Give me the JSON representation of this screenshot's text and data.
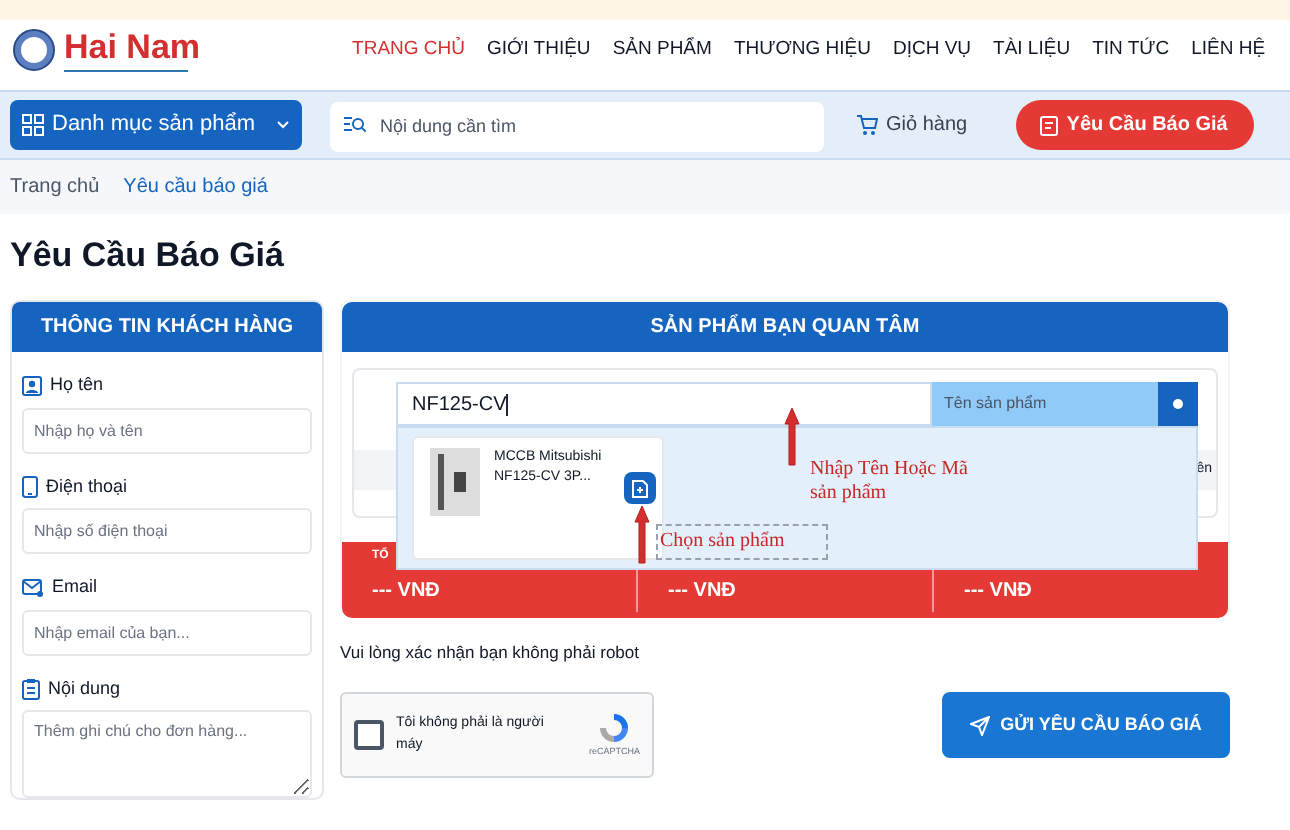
{
  "logo": {
    "name": "Hai Nam"
  },
  "nav": [
    {
      "label": "TRANG CHỦ",
      "selected": true
    },
    {
      "label": "GIỚI THIỆU",
      "selected": false
    },
    {
      "label": "SẢN PHẨM",
      "selected": false
    },
    {
      "label": "THƯƠNG HIỆU",
      "selected": false
    },
    {
      "label": "DỊCH VỤ",
      "selected": false
    },
    {
      "label": "TÀI LIỆU",
      "selected": false
    },
    {
      "label": "TIN TỨC",
      "selected": false
    },
    {
      "label": "LIÊN HỆ",
      "selected": false
    }
  ],
  "toolbar": {
    "category_button": "Danh mục sản phẩm",
    "search": {
      "placeholder": "Nội dung cần tìm"
    },
    "cart": "Giỏ hàng",
    "quote_button": "Yêu Cầu Báo Giá"
  },
  "breadcrumb": [
    "Trang chủ",
    "Yêu cầu báo giá"
  ],
  "title": "Yêu Cầu Báo Giá",
  "customer_panel": {
    "header": "THÔNG TIN KHÁCH HÀNG",
    "fields": [
      {
        "kind": "person",
        "label": "Họ tên",
        "placeholder": "Nhập họ và tên",
        "multiline": false
      },
      {
        "kind": "phone",
        "label": "Điện thoại",
        "placeholder": "Nhập số điện thoại",
        "multiline": false
      },
      {
        "kind": "email",
        "label": "Email",
        "placeholder": "Nhập email của bạn...",
        "multiline": false
      },
      {
        "kind": "note",
        "label": "Nội dung",
        "placeholder": "Thêm ghi chú cho đơn hàng...",
        "multiline": true
      }
    ]
  },
  "product_panel": {
    "header": "SẢN PHẨM BẠN QUAN TÂM",
    "search": {
      "value": "NF125-CV",
      "mode": "Tên sản phẩm"
    },
    "table_header_fragment": "ên",
    "suggestions": [
      {
        "name": "MCCB Mitsubishi NF125-CV 3P..."
      }
    ],
    "total_bar": {
      "label": "TỔ",
      "values": [
        "--- VNĐ",
        "--- VNĐ",
        "--- VNĐ"
      ]
    }
  },
  "annotations": [
    {
      "kind": "arrow",
      "text": "Nhập Tên Hoặc Mã sản phẩm"
    },
    {
      "kind": "selection",
      "text": "Chọn sản phẩm"
    }
  ],
  "captcha": {
    "prompt": "Vui lòng xác nhận bạn không phải robot",
    "label": "Tôi không phải là người máy",
    "checked": false,
    "brand": "reCAPTCHA"
  },
  "submit_button": "GỬI YÊU CẦU BÁO GIÁ"
}
